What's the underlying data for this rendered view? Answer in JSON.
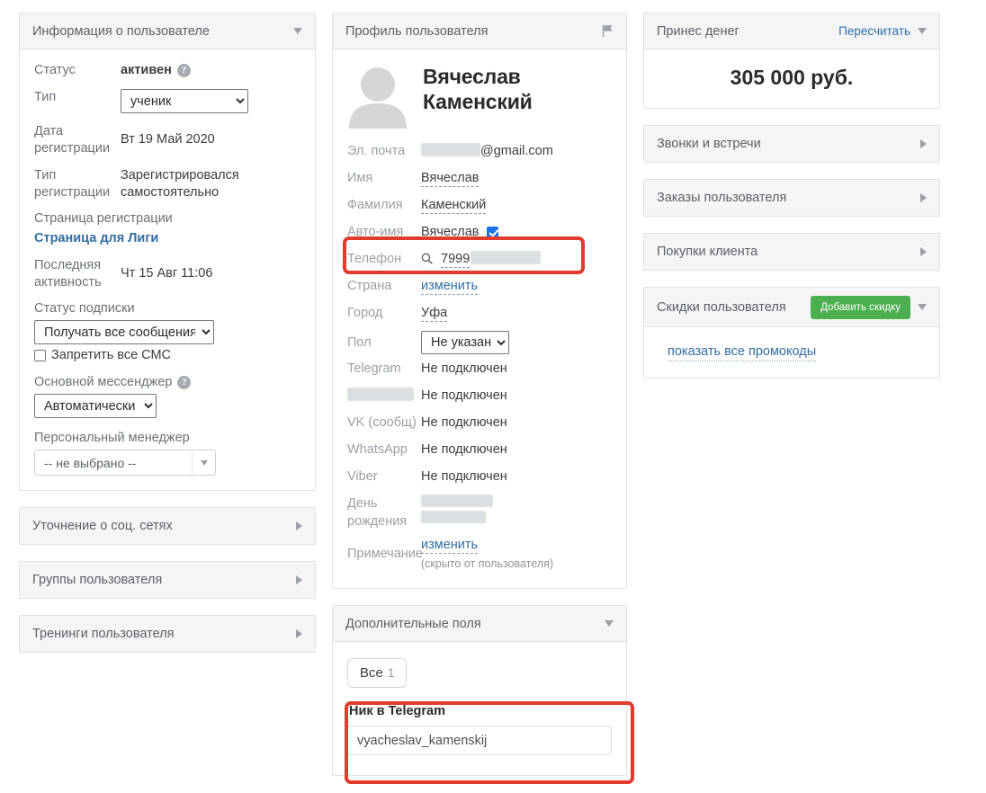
{
  "left": {
    "info_panel": {
      "title": "Информация о пользователе",
      "toggle_icon": "chevron-down-icon",
      "rows": {
        "status_label": "Статус",
        "status_value": "активен",
        "type_label": "Тип",
        "type_value": "ученик",
        "type_options": [
          "ученик"
        ],
        "reg_date_label": "Дата регистрации",
        "reg_date_value": "Вт 19 Май 2020",
        "reg_type_label": "Тип регистрации",
        "reg_type_value": "Зарегистрировался самостоятельно",
        "reg_page_label": "Страница регистрации",
        "reg_page_link": "Страница для Лиги",
        "last_activity_label": "Последняя активность",
        "last_activity_value": "Чт 15 Авг 11:06",
        "subscription_label": "Статус подписки",
        "subscription_value": "Получать все сообщения",
        "subscription_options": [
          "Получать все сообщения"
        ],
        "sms_checkbox_label": "Запретить все СМС",
        "messenger_label": "Основной мессенджер",
        "messenger_value": "Автоматически",
        "messenger_options": [
          "Автоматически"
        ],
        "manager_label": "Персональный менеджер",
        "manager_value": "-- не выбрано --"
      }
    },
    "collapsed_panels": [
      {
        "title": "Уточнение о соц. сетях",
        "toggle_icon": "chevron-right-icon"
      },
      {
        "title": "Группы пользователя",
        "toggle_icon": "chevron-right-icon"
      },
      {
        "title": "Тренинги пользователя",
        "toggle_icon": "chevron-right-icon"
      }
    ]
  },
  "middle": {
    "profile_panel": {
      "title": "Профиль пользователя",
      "flag_icon": "flag-icon",
      "avatar_icon": "user-avatar-placeholder-icon",
      "full_name": "Вячеслав Каменский",
      "fields": {
        "email_label": "Эл. почта",
        "email_masked_prefix": "",
        "email_domain": "@gmail.com",
        "first_name_label": "Имя",
        "first_name_value": "Вячеслав",
        "last_name_label": "Фамилия",
        "last_name_value": "Каменский",
        "auto_name_label": "Авто-имя",
        "auto_name_value": "Вячеслав",
        "auto_name_checked": true,
        "phone_label": "Телефон",
        "phone_value": "7999",
        "phone_search_icon": "search-icon",
        "country_label": "Страна",
        "country_value": "изменить",
        "city_label": "Город",
        "city_value": "Уфа",
        "gender_label": "Пол",
        "gender_value": "Не указан",
        "gender_options": [
          "Не указан"
        ],
        "telegram_label": "Telegram",
        "telegram_value": "Не подключен",
        "masked_label_value": "Не подключен",
        "vk_label": "VK (сообщ)",
        "vk_value": "Не подключен",
        "whatsapp_label": "WhatsApp",
        "whatsapp_value": "Не подключен",
        "viber_label": "Viber",
        "viber_value": "Не подключен",
        "birthday_label": "День рождения",
        "note_label": "Примечание",
        "note_value": "изменить",
        "note_hint": "(скрыто от пользователя)"
      }
    },
    "additional_panel": {
      "title": "Дополнительные поля",
      "toggle_icon": "chevron-down-icon",
      "tab_label": "Все",
      "tab_count": "1",
      "field_label": "Ник в Telegram",
      "field_value": "vyacheslav_kamenskij"
    }
  },
  "right": {
    "money_panel": {
      "title": "Принес денег",
      "recalc_link": "Пересчитать",
      "toggle_icon": "chevron-down-icon",
      "amount": "305 000 руб."
    },
    "collapsed_panels": [
      {
        "title": "Звонки и встречи",
        "toggle_icon": "chevron-right-icon"
      },
      {
        "title": "Заказы пользователя",
        "toggle_icon": "chevron-right-icon"
      },
      {
        "title": "Покупки клиента",
        "toggle_icon": "chevron-right-icon"
      }
    ],
    "discounts_panel": {
      "title": "Скидки пользователя",
      "add_button": "Добавить скидку",
      "toggle_icon": "chevron-down-icon",
      "promo_link": "показать все промокоды"
    }
  },
  "colors": {
    "accent_link": "#2f6ea5",
    "highlight_red": "#e23b2e",
    "button_green": "#4caf50",
    "checkbox_blue": "#1a73e8",
    "panel_header_bg": "#f4f5f6",
    "panel_border": "#e0e2e4"
  }
}
